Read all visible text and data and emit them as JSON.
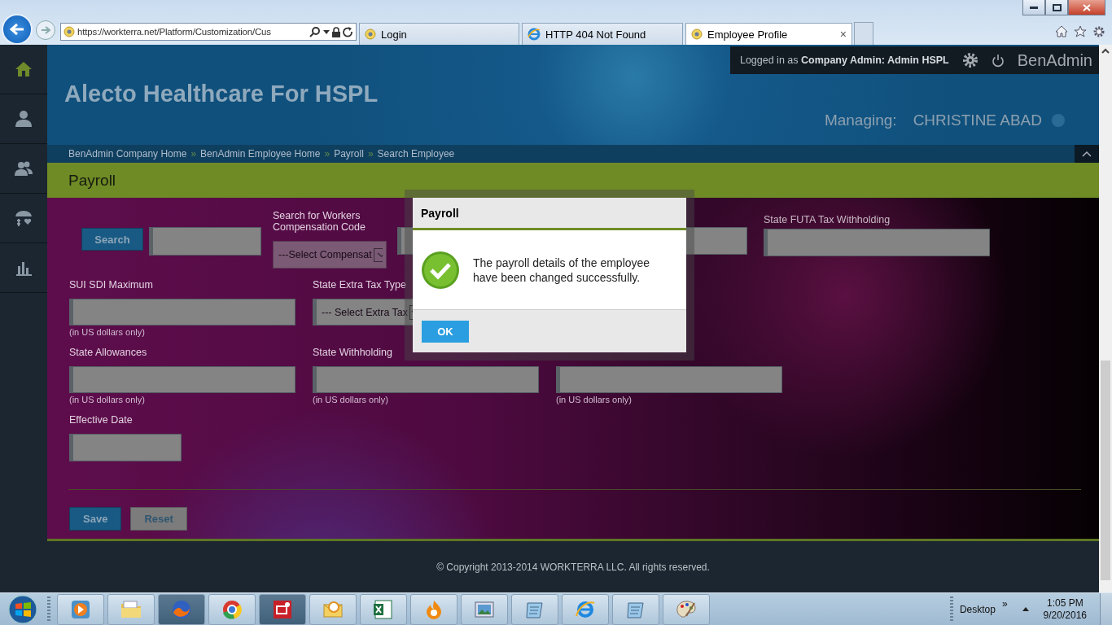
{
  "browser": {
    "url": "https://workterra.net/Platform/Customization/Cus",
    "close_tab": "×",
    "tabs": [
      {
        "title": "Login",
        "selected": false
      },
      {
        "title": "HTTP 404 Not Found",
        "selected": false
      },
      {
        "title": "Employee Profile",
        "selected": true
      }
    ]
  },
  "header": {
    "company": "Alecto Healthcare For HSPL",
    "login": "Logged in as **Company Admin:  Admin HSPL**",
    "product": "BenAdmin",
    "managing_label": "Managing:",
    "managing_name": "CHRISTINE ABAD"
  },
  "breadcrumb": {
    "separator": "»",
    "items": [
      "BenAdmin Company Home",
      "BenAdmin Employee Home",
      "Payroll",
      "Search Employee"
    ]
  },
  "page_title": "Payroll",
  "form": {
    "search_button": "Search",
    "comp_code": {
      "label": "Search for Workers Compensation Code",
      "placeholder": "---Select Compensat"
    },
    "futa_label": "State FUTA Tax Withholding",
    "rows": [
      [
        {
          "kind": "input",
          "label": "SUI SDI Maximum",
          "note": "(in US dollars only)"
        },
        {
          "kind": "select",
          "label": "State Extra Tax Type",
          "value": "--- Select Extra Tax"
        }
      ],
      [
        {
          "kind": "input",
          "label": "State Allowances",
          "note": "(in US dollars only)"
        },
        {
          "kind": "input",
          "label": "State Withholding",
          "note": "(in US dollars only)"
        },
        {
          "kind": "input",
          "note": "(in US dollars only)"
        }
      ],
      [
        {
          "kind": "date",
          "label": "Effective Date"
        }
      ]
    ],
    "buttons": [
      {
        "label": "Save",
        "kind": "primary"
      },
      {
        "label": "Reset",
        "kind": "secondary"
      }
    ]
  },
  "footer": "© Copyright 2013-2014 WORKTERRA LLC. All rights reserved.",
  "dialog": {
    "title": "Payroll",
    "message": "The payroll details of the employee have been changed successfully.",
    "button": "OK"
  },
  "taskbar": {
    "desktop": "Desktop",
    "chevron": "»",
    "time": "1:05 PM",
    "date": "9/20/2016"
  }
}
